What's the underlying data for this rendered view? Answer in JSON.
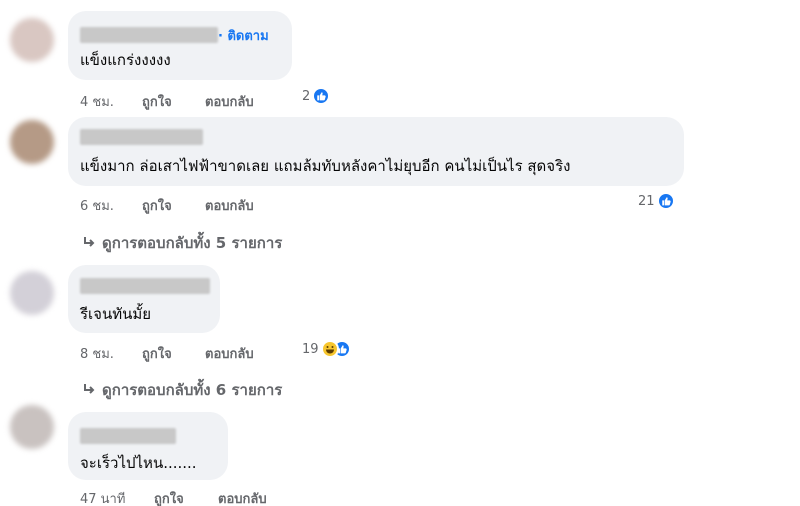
{
  "colors": {
    "bubble": "#f0f2f5",
    "link_blue": "#1877f2",
    "meta_gray": "#65676b",
    "text": "#050505"
  },
  "comments": [
    {
      "follow": "· ติดตาม",
      "text": "แข็งแกร่งงงงง",
      "time": "4 ชม.",
      "like": "ถูกใจ",
      "reply": "ตอบกลับ",
      "reaction_count": "2",
      "reactions": [
        "like-icon"
      ]
    },
    {
      "text": "แข็งมาก ล่อเสาไฟฟ้าขาดเลย แถมล้มทับหลังคาไม่ยุบอีก คนไม่เป็นไร สุดจริง",
      "time": "6 ชม.",
      "like": "ถูกใจ",
      "reply": "ตอบกลับ",
      "reaction_count": "21",
      "reactions": [
        "like-icon"
      ],
      "replies_label": "ดูการตอบกลับทั้ง 5 รายการ"
    },
    {
      "text": "รีเจนทันมั้ย",
      "time": "8 ชม.",
      "like": "ถูกใจ",
      "reply": "ตอบกลับ",
      "reaction_count": "19",
      "reactions": [
        "haha-icon",
        "like-icon"
      ],
      "replies_label": "ดูการตอบกลับทั้ง 6 รายการ"
    },
    {
      "text": "จะเร็วไปไหน.......",
      "time": "47 นาที",
      "like": "ถูกใจ",
      "reply": "ตอบกลับ"
    }
  ]
}
